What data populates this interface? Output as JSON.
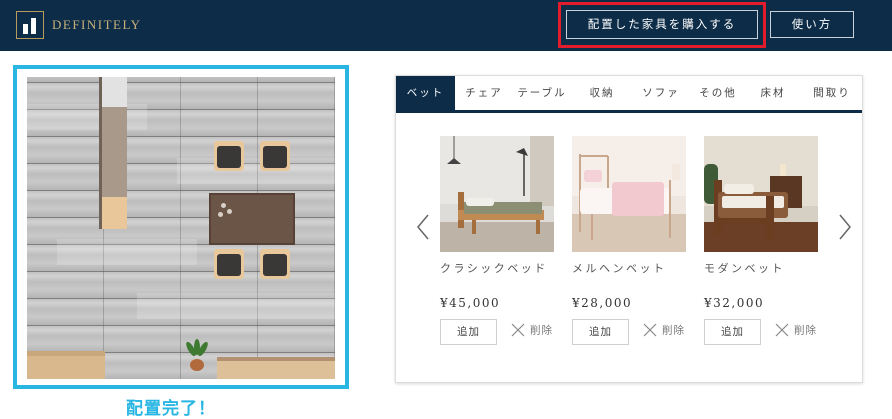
{
  "header": {
    "brand": "DEFINITELY",
    "purchase_label": "配置した家具を購入する",
    "howto_label": "使い方",
    "colors": {
      "background": "#0d2c47",
      "brand_text": "#c8b07c",
      "highlight": "#e21c2a"
    }
  },
  "plan": {
    "status_text": "配置完了！",
    "colors": {
      "frame": "#29b6e3"
    },
    "items": [
      "kitchen-counter",
      "dining-table",
      "dining-chair",
      "dining-chair",
      "dining-chair",
      "dining-chair",
      "potted-plant",
      "sofa",
      "sofa"
    ]
  },
  "catalog": {
    "tabs": [
      {
        "label": "ベット",
        "active": true
      },
      {
        "label": "チェア",
        "active": false
      },
      {
        "label": "テーブル",
        "active": false
      },
      {
        "label": "収納",
        "active": false
      },
      {
        "label": "ソファ",
        "active": false
      },
      {
        "label": "その他",
        "active": false
      },
      {
        "label": "床材",
        "active": false
      },
      {
        "label": "間取り",
        "active": false
      }
    ],
    "products": [
      {
        "name": "クラシックベッド",
        "price": "¥45,000",
        "add_label": "追加",
        "delete_label": "削除",
        "image_icon": "bed-photo-wood"
      },
      {
        "name": "メルヘンベット",
        "price": "¥28,000",
        "add_label": "追加",
        "delete_label": "削除",
        "image_icon": "bed-photo-pink"
      },
      {
        "name": "モダンベット",
        "price": "¥32,000",
        "add_label": "追加",
        "delete_label": "削除",
        "image_icon": "bed-photo-dark"
      }
    ],
    "nav": {
      "prev_icon": "chevron-left-icon",
      "next_icon": "chevron-right-icon"
    }
  }
}
